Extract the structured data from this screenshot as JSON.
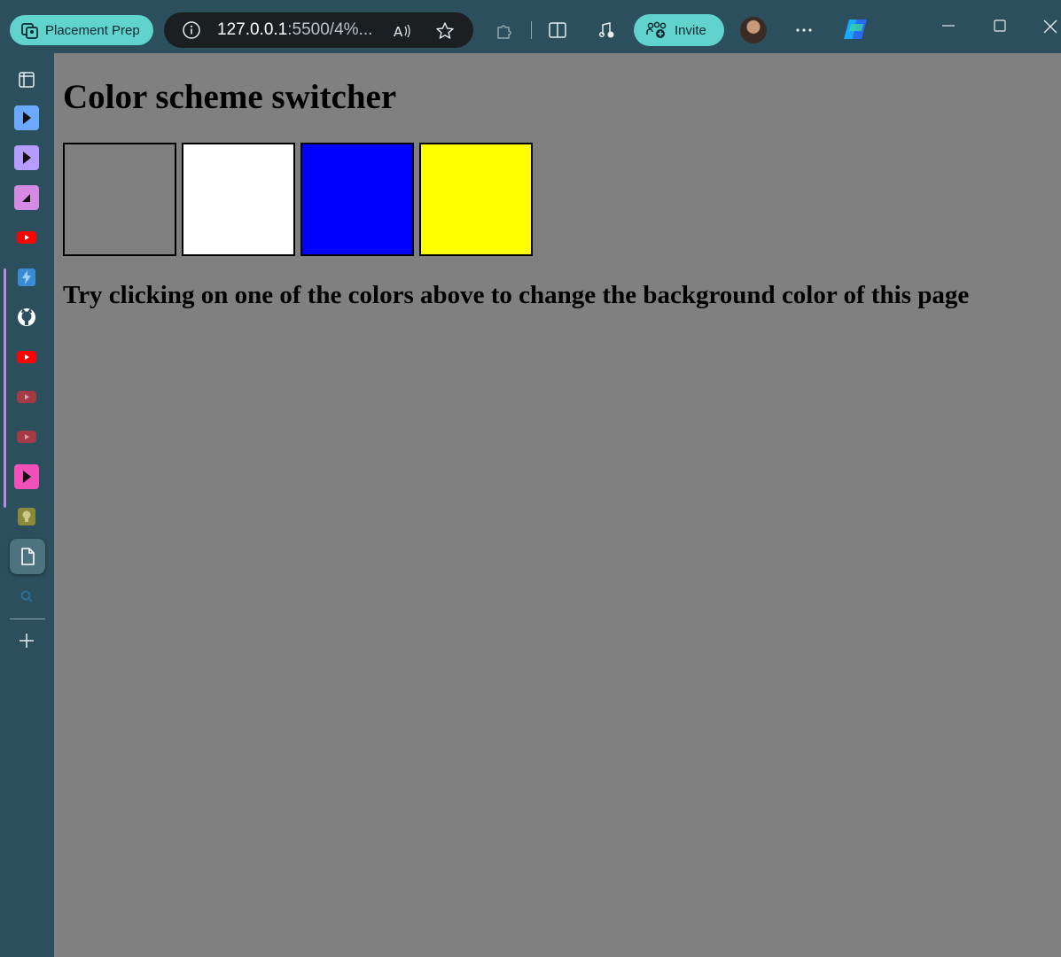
{
  "browser": {
    "profile_label": "Placement Prep",
    "url_host": "127.0.0.1",
    "url_path": ":5500/4%...",
    "invite_label": "Invite",
    "accent_color": "#5fd3cc",
    "frame_color": "#2b4f5c"
  },
  "sidebar": {
    "items": [
      {
        "icon": "tab-actions-icon"
      },
      {
        "icon": "blue-play-app-icon",
        "color": "#6aa9ff"
      },
      {
        "icon": "purple-play-app-icon",
        "color": "#b79cff"
      },
      {
        "icon": "pink-app-icon",
        "color": "#d58be3"
      },
      {
        "icon": "youtube-icon",
        "color": "#ff0000"
      },
      {
        "icon": "bolt-app-icon",
        "color": "#3a8bd6"
      },
      {
        "icon": "github-icon"
      },
      {
        "icon": "youtube-icon",
        "color": "#ff0000"
      },
      {
        "icon": "youtube-icon",
        "color": "#a33a45"
      },
      {
        "icon": "youtube-icon",
        "color": "#a33a45"
      },
      {
        "icon": "pink-play-app-icon",
        "color": "#f050b8"
      },
      {
        "icon": "bulb-app-icon",
        "color": "#8a8a3a"
      },
      {
        "icon": "document-icon"
      },
      {
        "icon": "search-icon"
      },
      {
        "icon": "add-icon"
      }
    ]
  },
  "page": {
    "heading": "Color scheme switcher",
    "swatches": [
      {
        "name": "grey",
        "color": "#808080"
      },
      {
        "name": "white",
        "color": "#ffffff"
      },
      {
        "name": "blue",
        "color": "#0000ff"
      },
      {
        "name": "yellow",
        "color": "#ffff00"
      }
    ],
    "instruction": "Try clicking on one of the colors above to change the background color of this page",
    "background": "#808080"
  }
}
